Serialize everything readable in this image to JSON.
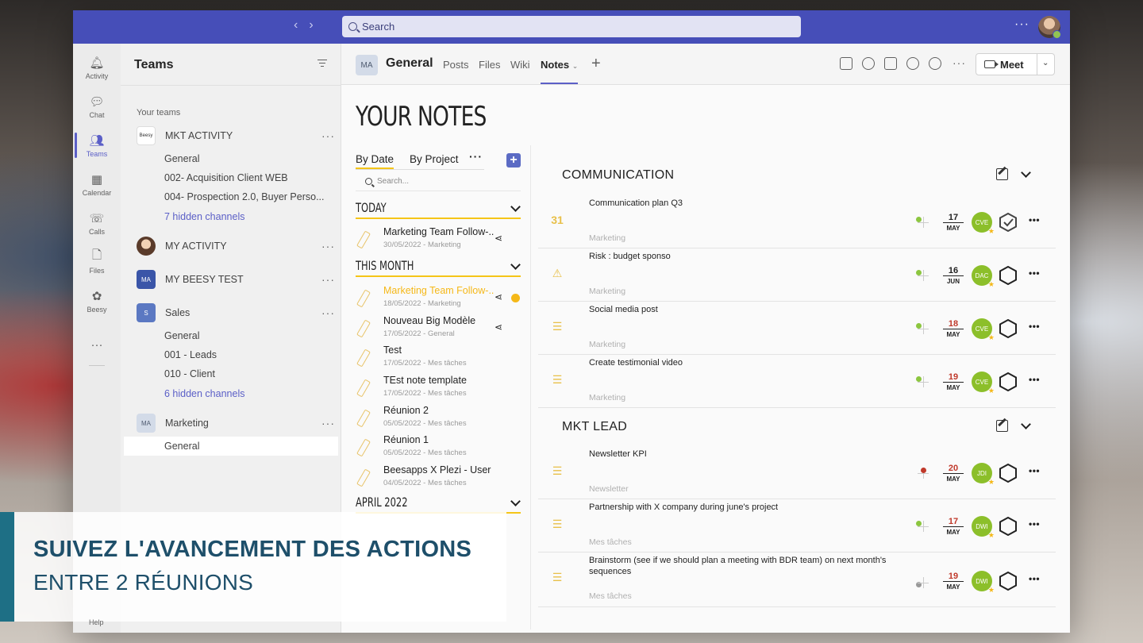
{
  "topbar": {
    "search_placeholder": "Search",
    "more": "···"
  },
  "rail": {
    "items": [
      {
        "label": "Activity",
        "icon": "bell-icon"
      },
      {
        "label": "Chat",
        "icon": "chat-icon"
      },
      {
        "label": "Teams",
        "icon": "teams-icon",
        "active": true
      },
      {
        "label": "Calendar",
        "icon": "calendar-icon"
      },
      {
        "label": "Calls",
        "icon": "phone-icon"
      },
      {
        "label": "Files",
        "icon": "file-icon"
      },
      {
        "label": "Beesy",
        "icon": "beesy-icon"
      }
    ],
    "more": "···",
    "help": "Help"
  },
  "teams_pane": {
    "title": "Teams",
    "section_label": "Your teams",
    "teams": [
      {
        "name": "MKT ACTIVITY",
        "avatar": "Beesy",
        "channels": [
          "General",
          "002- Acquisition Client WEB",
          "004- Prospection 2.0, Buyer Perso..."
        ],
        "hidden": "7 hidden channels"
      },
      {
        "name": "MY ACTIVITY",
        "avatar": ""
      },
      {
        "name": "MY BEESY TEST",
        "avatar": "MA"
      },
      {
        "name": "Sales",
        "avatar": "S",
        "channels": [
          "General",
          "001 - Leads",
          "010 - Client"
        ],
        "hidden": "6 hidden channels"
      },
      {
        "name": "Marketing",
        "avatar": "MA",
        "channels": [
          "General"
        ]
      }
    ]
  },
  "channel_header": {
    "avatar": "MA",
    "name": "General",
    "tabs": [
      "Posts",
      "Files",
      "Wiki",
      "Notes"
    ],
    "active_tab": "Notes",
    "meet_label": "Meet"
  },
  "notes_app": {
    "title": "YOUR NOTES",
    "tabs": [
      "By Date",
      "By Project"
    ],
    "search_placeholder": "Search...",
    "groups": [
      {
        "label": "TODAY",
        "notes": [
          {
            "title": "Marketing Team Follow-...",
            "date": "30/05/2022",
            "category": "Marketing",
            "shared": true
          }
        ]
      },
      {
        "label": "THIS MONTH",
        "notes": [
          {
            "title": "Marketing Team Follow-...",
            "date": "18/05/2022",
            "category": "Marketing",
            "shared": true,
            "highlight": true
          },
          {
            "title": "Nouveau Big Modèle",
            "date": "17/05/2022",
            "category": "General",
            "shared": true
          },
          {
            "title": "Test",
            "date": "17/05/2022",
            "category": "Mes tâches"
          },
          {
            "title": "TEst note template",
            "date": "17/05/2022",
            "category": "Mes tâches"
          },
          {
            "title": "Réunion 2",
            "date": "05/05/2022",
            "category": "Mes tâches"
          },
          {
            "title": "Réunion 1",
            "date": "05/05/2022",
            "category": "Mes tâches"
          },
          {
            "title": "Beesapps X Plezi - User",
            "date": "04/05/2022",
            "category": "Mes tâches"
          }
        ]
      },
      {
        "label": "APRIL 2022",
        "notes": []
      }
    ],
    "sections": [
      {
        "title": "COMMUNICATION",
        "rows": [
          {
            "icon": "calendar-31-icon",
            "title": "Communication plan Q3",
            "category": "Marketing",
            "day": "17",
            "month": "MAY",
            "avatar": "CVE",
            "status": "done",
            "pin": "#8cc63f"
          },
          {
            "icon": "warning-icon",
            "title": "Risk : budget sponso",
            "category": "Marketing",
            "day": "16",
            "month": "JUN",
            "avatar": "DAC",
            "status": "open",
            "pin": "#8cc63f"
          },
          {
            "icon": "checklist-icon",
            "title": "Social media post",
            "category": "Marketing",
            "day": "18",
            "month": "MAY",
            "avatar": "CVE",
            "status": "open",
            "pin": "#8cc63f",
            "late": true
          },
          {
            "icon": "checklist-icon",
            "title": "Create testimonial video",
            "category": "Marketing",
            "day": "19",
            "month": "MAY",
            "avatar": "CVE",
            "status": "open",
            "pin": "#8cc63f",
            "late": true
          }
        ]
      },
      {
        "title": "MKT LEAD",
        "rows": [
          {
            "icon": "checklist-icon",
            "title": "Newsletter KPI",
            "category": "Newsletter",
            "day": "20",
            "month": "MAY",
            "avatar": "JDI",
            "status": "open",
            "pin": "#c0392b",
            "late": true
          },
          {
            "icon": "checklist-icon",
            "title": "Partnership with X company during june's project",
            "category": "Mes tâches",
            "day": "17",
            "month": "MAY",
            "avatar": "DWI",
            "status": "open",
            "pin": "#8cc63f",
            "late": true
          },
          {
            "icon": "checklist-icon",
            "title": "Brainstorm (see if we should plan a meeting with BDR team) on next month's sequences",
            "category": "Mes tâches",
            "day": "19",
            "month": "MAY",
            "avatar": "DWI",
            "status": "open",
            "pin": "#999999",
            "late": true
          }
        ]
      }
    ]
  },
  "banner": {
    "line1": "SUIVEZ L'AVANCEMENT DES ACTIONS",
    "line2": "ENTRE 2 RÉUNIONS"
  },
  "colors": {
    "teams_purple": "#464eb8",
    "accent_yellow": "#f5c518",
    "avatar_green": "#8cbf2a",
    "banner_text": "#1e4f6a"
  }
}
